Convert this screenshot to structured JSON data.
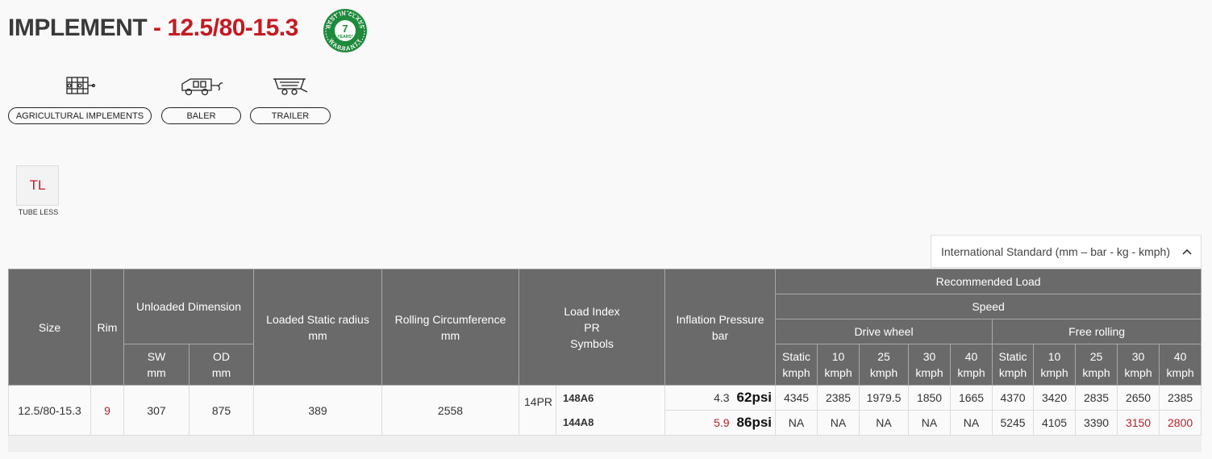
{
  "product": {
    "title_main": "IMPLEMENT",
    "title_sub": "- 12.5/80-15.3",
    "badge": {
      "top": "BEST IN CLASS",
      "number": "7",
      "mid": "YEARS*",
      "bottom": "WARRANTY",
      "color": "#1e8a3c"
    }
  },
  "categories": [
    {
      "label": "AGRICULTURAL IMPLEMENTS",
      "icon": "agricultural-implement-icon"
    },
    {
      "label": "BALER",
      "icon": "baler-icon"
    },
    {
      "label": "TRAILER",
      "icon": "trailer-icon"
    }
  ],
  "tyre_type": {
    "code": "TL",
    "label": "TUBE LESS"
  },
  "unit_select": {
    "value": "International Standard (mm – bar - kg - kmph)"
  },
  "table": {
    "headers": {
      "size": "Size",
      "rim": "Rim",
      "unloaded": "Unloaded Dimension",
      "sw": [
        "SW",
        "mm"
      ],
      "od": [
        "OD",
        "mm"
      ],
      "loaded": [
        "Loaded Static radius",
        "mm"
      ],
      "rolling": [
        "Rolling Circumference",
        "mm"
      ],
      "load_index": [
        "Load Index",
        "PR",
        "Symbols"
      ],
      "inflation": [
        "Inflation Pressure",
        "bar"
      ],
      "recommended": "Recommended Load",
      "speed": "Speed",
      "drive": "Drive wheel",
      "free": "Free rolling",
      "speed_cols": [
        [
          "Static",
          "kmph"
        ],
        [
          "10",
          "kmph"
        ],
        [
          "25",
          "kmph"
        ],
        [
          "30",
          "kmph"
        ],
        [
          "40",
          "kmph"
        ],
        [
          "Static",
          "kmph"
        ],
        [
          "10",
          "kmph"
        ],
        [
          "25",
          "kmph"
        ],
        [
          "30",
          "kmph"
        ],
        [
          "40",
          "kmph"
        ]
      ]
    },
    "row": {
      "size": "12.5/80-15.3",
      "rim": "9",
      "sw": "307",
      "od": "875",
      "loaded": "389",
      "rolling": "2558",
      "pr": "14PR",
      "sub": [
        {
          "symbol": "148A6",
          "bar": "4.3",
          "psi": "62psi",
          "loads": [
            "4345",
            "2385",
            "1979.5",
            "1850",
            "1665",
            "4370",
            "3420",
            "2835",
            "2650",
            "2385"
          ]
        },
        {
          "symbol": "144A8",
          "bar": "5.9",
          "psi": "86psi",
          "loads": [
            "NA",
            "NA",
            "NA",
            "NA",
            "NA",
            "5245",
            "4105",
            "3390",
            "3150",
            "2800"
          ]
        }
      ]
    }
  }
}
